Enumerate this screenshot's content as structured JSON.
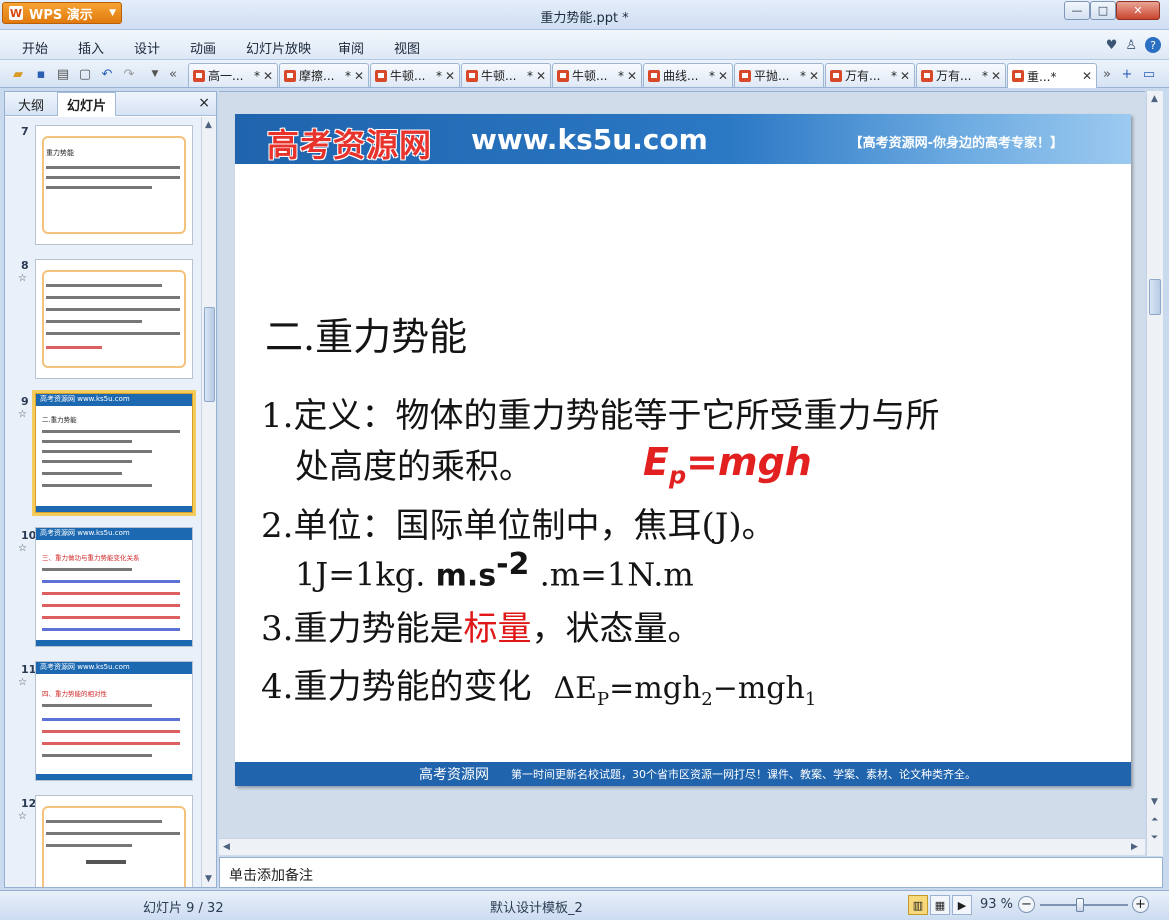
{
  "app": {
    "button_label": "WPS 演示",
    "window_title": "重力势能.ppt *"
  },
  "window_controls": {
    "minimize": "—",
    "maximize": "□",
    "close": "✕"
  },
  "menu": {
    "items": [
      "开始",
      "插入",
      "设计",
      "动画",
      "幻灯片放映",
      "审阅",
      "视图"
    ]
  },
  "doc_tabs": [
    {
      "label": "高一...",
      "modified": "*",
      "active": false
    },
    {
      "label": "摩擦...",
      "modified": "*",
      "active": false
    },
    {
      "label": "牛顿...",
      "modified": "*",
      "active": false
    },
    {
      "label": "牛顿...",
      "modified": "*",
      "active": false
    },
    {
      "label": "牛顿...",
      "modified": "*",
      "active": false
    },
    {
      "label": "曲线...",
      "modified": "*",
      "active": false
    },
    {
      "label": "平抛...",
      "modified": "*",
      "active": false
    },
    {
      "label": "万有...",
      "modified": "*",
      "active": false
    },
    {
      "label": "万有...",
      "modified": "*",
      "active": false
    },
    {
      "label": "重...*",
      "modified": "",
      "active": true
    }
  ],
  "left_pane": {
    "tab_outline": "大纲",
    "tab_slides": "幻灯片",
    "close": "×",
    "slides": [
      {
        "num": "7",
        "star": "",
        "header": "",
        "selected": false,
        "title": "重力势能"
      },
      {
        "num": "8",
        "star": "☆",
        "header": "",
        "selected": false,
        "title": ""
      },
      {
        "num": "9",
        "star": "☆",
        "header": "高考资源网  www.ks5u.com",
        "selected": true,
        "title": "二.重力势能"
      },
      {
        "num": "10",
        "star": "☆",
        "header": "高考资源网  www.ks5u.com",
        "selected": false,
        "title": "三、重力做功与重力势能变化关系"
      },
      {
        "num": "11",
        "star": "☆",
        "header": "高考资源网  www.ks5u.com",
        "selected": false,
        "title": "四、重力势能的相对性"
      },
      {
        "num": "12",
        "star": "☆",
        "header": "",
        "selected": false,
        "title": ""
      }
    ]
  },
  "slide": {
    "banner_logo": "高考资源网",
    "banner_url": "www.ks5u.com",
    "banner_slogan": "【高考资源网-你身边的高考专家！】",
    "heading": "二.重力势能",
    "item1_line1": "1.定义：物体的重力势能等于它所受重力与所",
    "item1_line2": "处高度的乘积。",
    "formula_e": "E",
    "formula_p": "p",
    "formula_rest": "=mgh",
    "item2_line1": "2.单位：国际单位制中，焦耳(J)。",
    "item2_line2_pre": "1J=1kg.",
    "item2_line2_bold": "m.s",
    "item2_line2_sup": "-2",
    "item2_line2_post": ".m=1N.m",
    "item3_pre": "3.重力势能是",
    "item3_red": "标量",
    "item3_post": "，状态量。",
    "item4_text": "4.重力势能的变化",
    "item4_formula_a": "ΔE",
    "item4_formula_p": "P",
    "item4_formula_b": "=mgh",
    "item4_formula_2": "2",
    "item4_formula_c": "−mgh",
    "item4_formula_1": "1",
    "footer_brand": "高考资源网",
    "footer_text": "第一时间更新名校试题，30个省市区资源一网打尽！课件、教案、学案、素材、论文种类齐全。"
  },
  "notes_placeholder": "单击添加备注",
  "status": {
    "slide_position": "幻灯片 9 / 32",
    "template": "默认设计模板_2",
    "zoom": "93 %",
    "zoom_minus": "−",
    "zoom_plus": "+",
    "zoom_fraction": 0.45
  },
  "colors": {
    "accent": "#1f64ad",
    "formula_red": "#e32020",
    "selected_thumb": "#f4cc5d"
  }
}
